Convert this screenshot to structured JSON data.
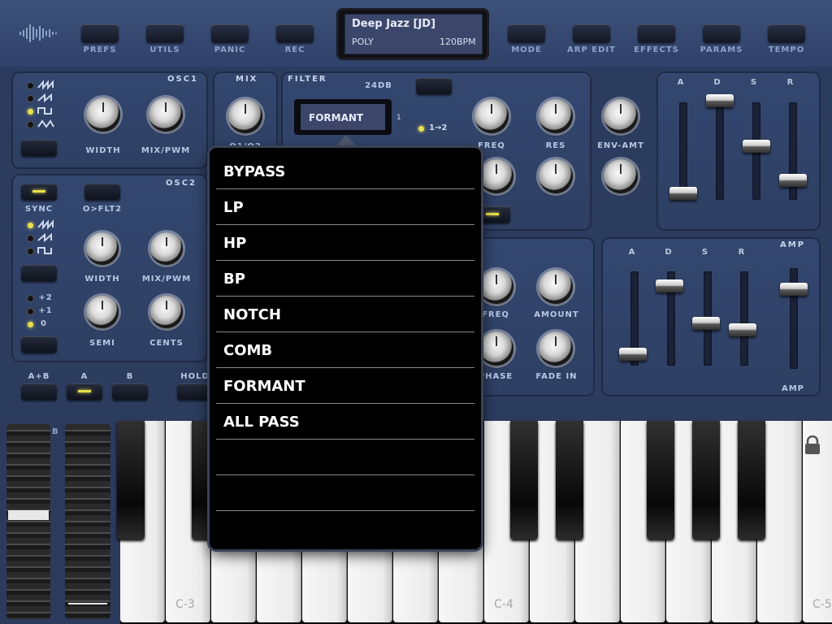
{
  "topbar": {
    "buttons": [
      "PREFS",
      "UTILS",
      "PANIC",
      "REC",
      "MODE",
      "ARP EDIT",
      "EFFECTS",
      "PARAMS",
      "TEMPO"
    ]
  },
  "lcd": {
    "patch": "Deep Jazz [JD]",
    "mode": "POLY",
    "tempo": "120BPM"
  },
  "osc1": {
    "title": "OSC1",
    "knobs": [
      "WIDTH",
      "MIX/PWM"
    ]
  },
  "mix": {
    "title": "MIX",
    "label": "O1/O2"
  },
  "osc2": {
    "title": "OSC2",
    "sync": "SYNC",
    "oflt": "O>FLT2",
    "knobs": [
      "WIDTH",
      "MIX/PWM"
    ],
    "knobs2": [
      "SEMI",
      "CENTS"
    ],
    "octaves": [
      "+2",
      "+1",
      "0"
    ]
  },
  "filter": {
    "title": "FILTER",
    "slope": "24DB",
    "type": "FORMANT",
    "number": "1",
    "route": "1→2",
    "knobs": [
      "FREQ",
      "RES",
      "ENV-AMT"
    ]
  },
  "adsr_top": [
    "A",
    "D",
    "S",
    "R"
  ],
  "lfo": {
    "knobs": [
      "FREQ",
      "AMOUNT",
      "PHASE",
      "FADE IN"
    ]
  },
  "amp": {
    "title": "AMP",
    "label": "AMP",
    "adsr": [
      "A",
      "D",
      "S",
      "R"
    ]
  },
  "bottom_buttons": [
    "A+B",
    "A",
    "B",
    "HOLD"
  ],
  "wheel_label": "B",
  "keyboard": {
    "labels": [
      "C-3",
      "C-4",
      "C-5"
    ]
  },
  "popup": {
    "items": [
      "BYPASS",
      "LP",
      "HP",
      "BP",
      "NOTCH",
      "COMB",
      "FORMANT",
      "ALL PASS",
      "",
      "",
      ""
    ]
  },
  "colors": {
    "panel": "#34476f",
    "led_on": "#e8e04a",
    "popup_bg": "#000000"
  }
}
